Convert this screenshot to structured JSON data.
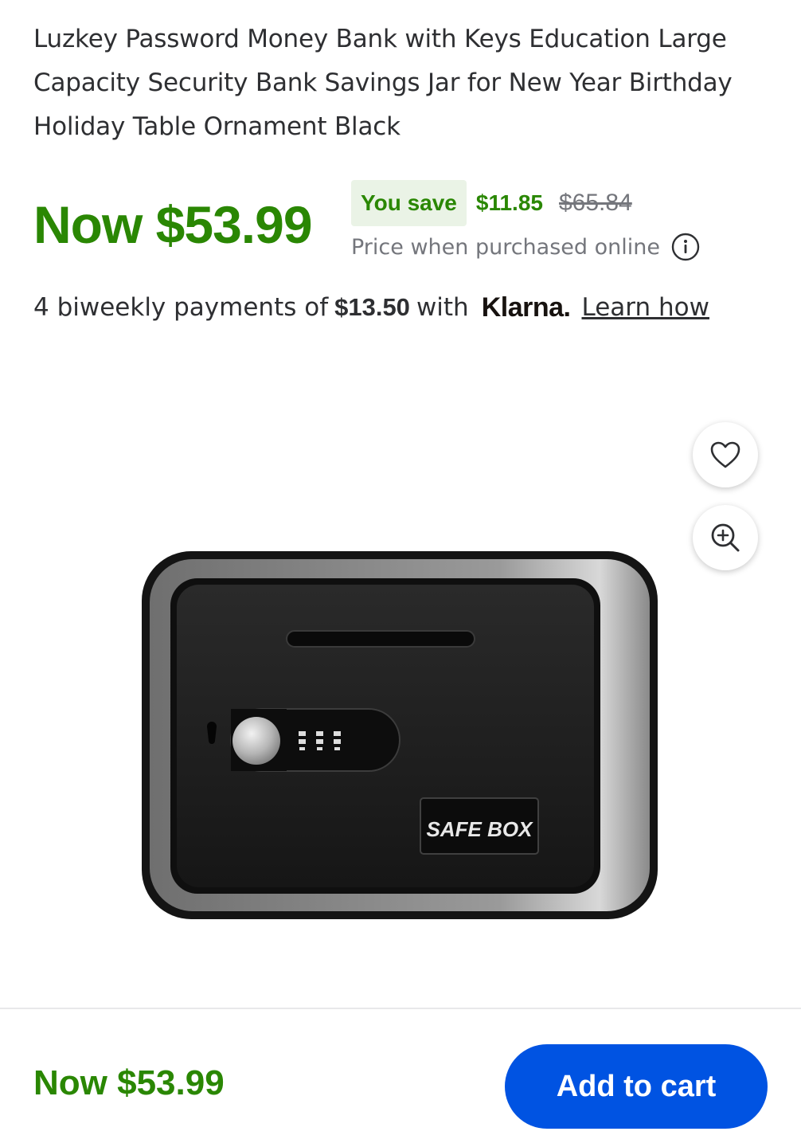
{
  "product": {
    "title": "Luzkey Password Money Bank with Keys Education Large Capacity Security Bank Savings Jar for New Year Birthday Holiday Table Ornament Black",
    "image_alt": "SAFE BOX",
    "image_label": "SAFE BOX"
  },
  "pricing": {
    "now_price": "Now $53.99",
    "you_save_label": "You save",
    "save_amount": "$11.85",
    "was_price": "$65.84",
    "price_note": "Price when purchased online",
    "info_icon": "info-icon"
  },
  "klarna": {
    "prefix": "4 biweekly payments of",
    "amount": "$13.50",
    "with": "with",
    "logo": "Klarna.",
    "link": "Learn how"
  },
  "actions": {
    "favorite_icon": "heart-icon",
    "zoom_icon": "zoom-in-icon"
  },
  "bottom_bar": {
    "price": "Now $53.99",
    "cart_button": "Add to cart"
  },
  "colors": {
    "price_green": "#2a8703",
    "save_bg": "#eaf3e6",
    "cart_blue": "#0053e2",
    "muted_text": "#74767c"
  }
}
